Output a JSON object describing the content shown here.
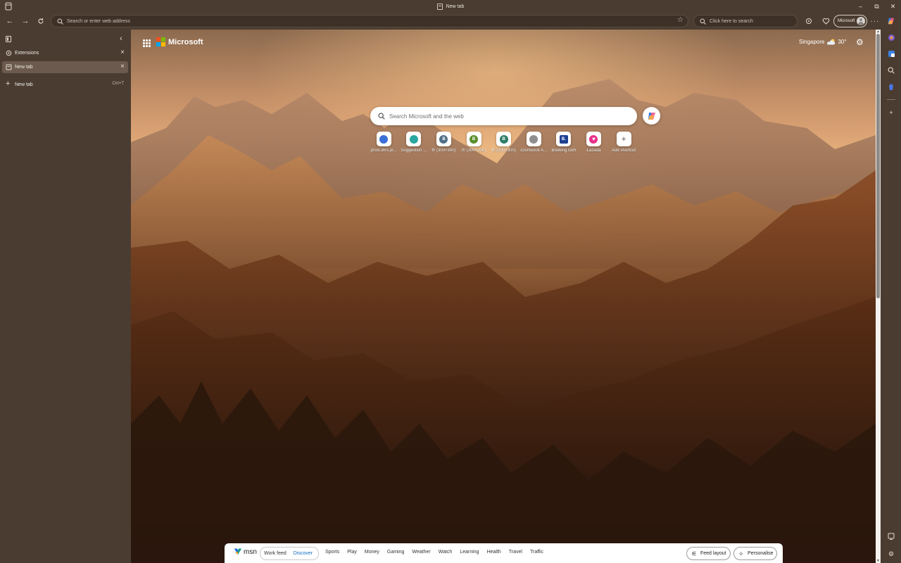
{
  "window": {
    "title": "New tab",
    "controls": [
      "–",
      "⧉",
      "✕"
    ]
  },
  "toolbar": {
    "address_placeholder": "Search or enter web address",
    "search_placeholder": "Click here to search",
    "profile_label": "Microsoft"
  },
  "vertical_tabs": {
    "tabs": [
      {
        "label": "Extensions",
        "active": false
      },
      {
        "label": "New tab",
        "active": true
      }
    ],
    "new_tab_label": "New tab",
    "new_tab_shortcut": "Ctrl+T"
  },
  "newtab_page": {
    "brand": "Microsoft",
    "weather": {
      "location": "Singapore",
      "temperature": "30°"
    },
    "search_placeholder": "Search Microsoft and the web",
    "shortcuts": [
      {
        "label": "prod.uhrs.pl...",
        "letter": "",
        "color": "#3a6fd8"
      },
      {
        "label": "Suggestion ...",
        "letter": "",
        "color": "#2aa7a0"
      },
      {
        "label": "th (300×300)",
        "letter": "B",
        "color": "#4f6f86"
      },
      {
        "label": "th (300×300)",
        "letter": "B",
        "color": "#5c8f2c"
      },
      {
        "label": "th (300×300)",
        "letter": "B",
        "color": "#2f7e69"
      },
      {
        "label": "cosmos08 A...",
        "letter": "",
        "color": "#8e8e8e"
      },
      {
        "label": "Booking.com",
        "letter": "B.",
        "color": "#1d3f91"
      },
      {
        "label": "Lazada",
        "letter": "♥",
        "color": "#e8308a"
      },
      {
        "label": "Add shortcut",
        "letter": "+",
        "color": "#ffffff"
      }
    ]
  },
  "msn_bar": {
    "logo": "msn",
    "segments": [
      {
        "label": "Work feed",
        "active": false
      },
      {
        "label": "Discover",
        "active": true
      }
    ],
    "categories": [
      "Sports",
      "Play",
      "Money",
      "Gaming",
      "Weather",
      "Watch",
      "Learning",
      "Health",
      "Travel",
      "Traffic"
    ],
    "feed_layout_label": "Feed layout",
    "personalise_label": "Personalise"
  },
  "colors": {
    "chrome": "#4a3c31",
    "accent_link": "#0f6cbd"
  }
}
